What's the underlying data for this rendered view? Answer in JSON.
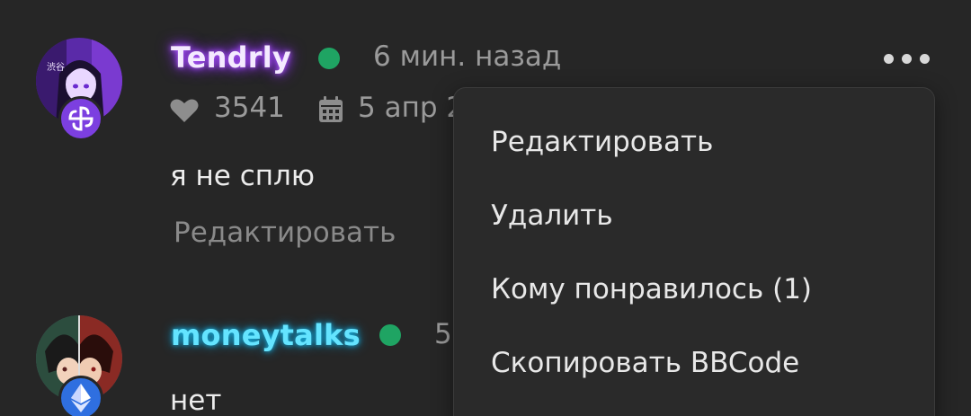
{
  "posts": [
    {
      "username": "Tendrly",
      "online": true,
      "time_ago": "6 мин. назад",
      "likes": "3541",
      "date": "5 апр 2",
      "message": "я не сплю",
      "edit_label": "Редактировать"
    },
    {
      "username": "moneytalks",
      "online": true,
      "time_ago": "5",
      "message": "нет"
    }
  ],
  "context_menu": {
    "items": [
      {
        "label": "Редактировать"
      },
      {
        "label": "Удалить"
      },
      {
        "label": "Кому понравилось (1)"
      },
      {
        "label": "Скопировать BBCode"
      }
    ]
  },
  "icons": {
    "more": "more-horizontal-icon",
    "likes": "heart-icon",
    "date": "calendar-icon",
    "badge1": "pinwheel-icon",
    "badge2": "ethereum-icon"
  },
  "colors": {
    "background": "#262626",
    "online": "#1fa463",
    "username1_glow": "#9b3dff",
    "username2": "#64e4ff",
    "menu_bg": "#2a2a2a"
  }
}
